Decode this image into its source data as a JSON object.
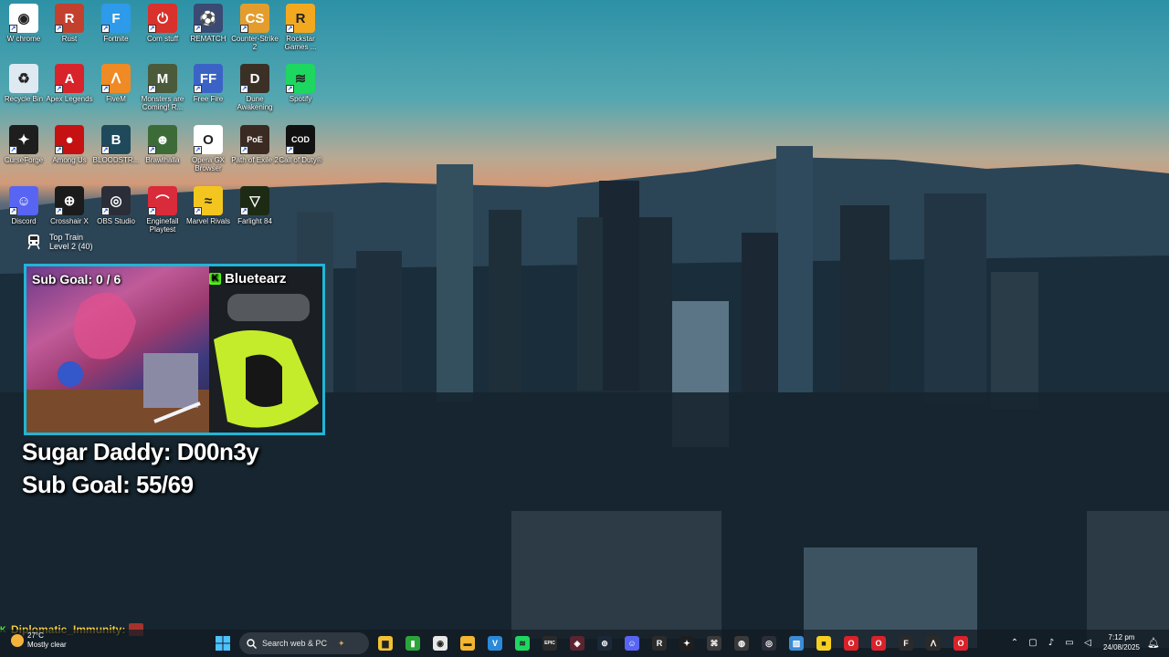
{
  "desktop": {
    "icons": [
      {
        "label": "W chrome",
        "icon": "chrome-icon",
        "color": "#ffffff",
        "glyph": "◉"
      },
      {
        "label": "Rust",
        "icon": "rust-icon",
        "color": "#c2402d",
        "glyph": "R"
      },
      {
        "label": "Fortnite",
        "icon": "fortnite-icon",
        "color": "#2d9bea",
        "glyph": "F"
      },
      {
        "label": "Com stuff",
        "icon": "power-icon",
        "color": "#d9312b",
        "glyph": "⏻"
      },
      {
        "label": "REMATCH",
        "icon": "soccer-ball-icon",
        "color": "#3a4a72",
        "glyph": "⚽"
      },
      {
        "label": "Counter-Strike 2",
        "icon": "counter-strike-icon",
        "color": "#e49d2c",
        "glyph": "CS"
      },
      {
        "label": "Rockstar Games ...",
        "icon": "rockstar-icon",
        "color": "#f3a91f",
        "glyph": "R"
      },
      {
        "label": "Recycle Bin",
        "icon": "recycle-bin-icon",
        "color": "#dfe9f2",
        "glyph": "♻"
      },
      {
        "label": "Apex Legends",
        "icon": "apex-icon",
        "color": "#d8232a",
        "glyph": "A"
      },
      {
        "label": "FiveM",
        "icon": "fivem-icon",
        "color": "#f08a24",
        "glyph": "ᐱ"
      },
      {
        "label": "Monsters are Coming! R...",
        "icon": "monsters-icon",
        "color": "#4a5a3a",
        "glyph": "M"
      },
      {
        "label": "Free Fire",
        "icon": "free-fire-icon",
        "color": "#3b63c6",
        "glyph": "FF"
      },
      {
        "label": "Dune Awakening",
        "icon": "dune-icon",
        "color": "#3a3026",
        "glyph": "D"
      },
      {
        "label": "Spotify",
        "icon": "spotify-icon",
        "color": "#1ed760",
        "glyph": "≋"
      },
      {
        "label": "CurseForge",
        "icon": "curseforge-icon",
        "color": "#1e1e1e",
        "glyph": "✦"
      },
      {
        "label": "Among Us",
        "icon": "among-us-icon",
        "color": "#c51111",
        "glyph": "●"
      },
      {
        "label": "BLOODSTR...",
        "icon": "bloodstrike-icon",
        "color": "#1f4a5c",
        "glyph": "B"
      },
      {
        "label": "Brawlhalla",
        "icon": "brawlhalla-icon",
        "color": "#3d6b38",
        "glyph": "☻"
      },
      {
        "label": "Opera GX Browser",
        "icon": "opera-gx-icon",
        "color": "#ffffff",
        "glyph": "O"
      },
      {
        "label": "Path of Exile 2",
        "icon": "path-of-exile-icon",
        "color": "#3a2a22",
        "glyph": "PoE"
      },
      {
        "label": "Call of Duty®",
        "icon": "call-of-duty-icon",
        "color": "#111111",
        "glyph": "COD"
      },
      {
        "label": "Discord",
        "icon": "discord-icon",
        "color": "#5865f2",
        "glyph": "☺"
      },
      {
        "label": "Crosshair X",
        "icon": "crosshair-icon",
        "color": "#1b1b1b",
        "glyph": "⊕"
      },
      {
        "label": "OBS Studio",
        "icon": "obs-icon",
        "color": "#2b2e38",
        "glyph": "◎"
      },
      {
        "label": "Enginefall Playtest",
        "icon": "enginefall-icon",
        "color": "#d92b3a",
        "glyph": "⌒"
      },
      {
        "label": "Marvel Rivals",
        "icon": "marvel-rivals-icon",
        "color": "#f2c61e",
        "glyph": "≈"
      },
      {
        "label": "Farlight 84",
        "icon": "farlight-icon",
        "color": "#1d2a14",
        "glyph": "▽"
      }
    ],
    "top_train": {
      "line1": "Top Train",
      "line2": "Level 2  (40)"
    }
  },
  "stream_overlay": {
    "cam_sub_goal": "Sub Goal:  0 / 6",
    "cam_name": "Bluetearz",
    "line1": "Sugar Daddy: D00n3y",
    "line2": "Sub Goal: 55/69",
    "chat_user": "Diplomatic_Immunity:"
  },
  "taskbar": {
    "weather_temp": "27°C",
    "weather_desc": "Mostly clear",
    "search_placeholder": "Search web & PC",
    "apps": [
      {
        "name": "file-explorer-icon",
        "color": "#f2c233",
        "glyph": "▆"
      },
      {
        "name": "xbox-app-icon",
        "color": "#2ba53a",
        "glyph": "▮"
      },
      {
        "name": "chrome-taskbar-icon",
        "color": "#e8e8e8",
        "glyph": "◉"
      },
      {
        "name": "folder-icon",
        "color": "#f2b632",
        "glyph": "▬"
      },
      {
        "name": "vscode-icon",
        "color": "#2a8ad9",
        "glyph": "V"
      },
      {
        "name": "spotify-taskbar-icon",
        "color": "#1ed760",
        "glyph": "≋"
      },
      {
        "name": "epic-games-icon",
        "color": "#2a2a2a",
        "glyph": "EPIC"
      },
      {
        "name": "valorant-icon",
        "color": "#5a2430",
        "glyph": "◈"
      },
      {
        "name": "steam-icon",
        "color": "#1b2838",
        "glyph": "⊚"
      },
      {
        "name": "discord-taskbar-icon",
        "color": "#5865f2",
        "glyph": "☺"
      },
      {
        "name": "rockstar-taskbar-icon",
        "color": "#2b2b2b",
        "glyph": "R"
      },
      {
        "name": "curseforge-taskbar-icon",
        "color": "#1e1e1e",
        "glyph": "✦"
      },
      {
        "name": "app-icon",
        "color": "#3a3a3a",
        "glyph": "⌘"
      },
      {
        "name": "nvidia-icon",
        "color": "#3a3a3a",
        "glyph": "◍"
      },
      {
        "name": "obs-taskbar-icon",
        "color": "#2b2e38",
        "glyph": "◎"
      },
      {
        "name": "photos-icon",
        "color": "#3b8bd6",
        "glyph": "▨"
      },
      {
        "name": "sticky-notes-icon",
        "color": "#f5d020",
        "glyph": "■"
      },
      {
        "name": "opera-taskbar-icon",
        "color": "#d9222a",
        "glyph": "O"
      },
      {
        "name": "opera-gx-taskbar-icon",
        "color": "#d9222a",
        "glyph": "O"
      },
      {
        "name": "fortnite-taskbar-icon",
        "color": "#2a2a2a",
        "glyph": "F"
      },
      {
        "name": "fivem-taskbar-icon",
        "color": "#2a2a2a",
        "glyph": "ᐱ"
      },
      {
        "name": "opera-gx-2-taskbar-icon",
        "color": "#d9222a",
        "glyph": "O"
      }
    ],
    "tray": [
      {
        "name": "chevron-up-icon",
        "glyph": "⌃"
      },
      {
        "name": "window-icon",
        "glyph": "▢"
      },
      {
        "name": "microphone-icon",
        "glyph": "♪"
      },
      {
        "name": "monitor-icon",
        "glyph": "▭"
      },
      {
        "name": "speaker-icon",
        "glyph": "◁"
      }
    ],
    "time": "7:12 pm",
    "date": "24/08/2025",
    "accent_color": "#1fb6d8"
  }
}
